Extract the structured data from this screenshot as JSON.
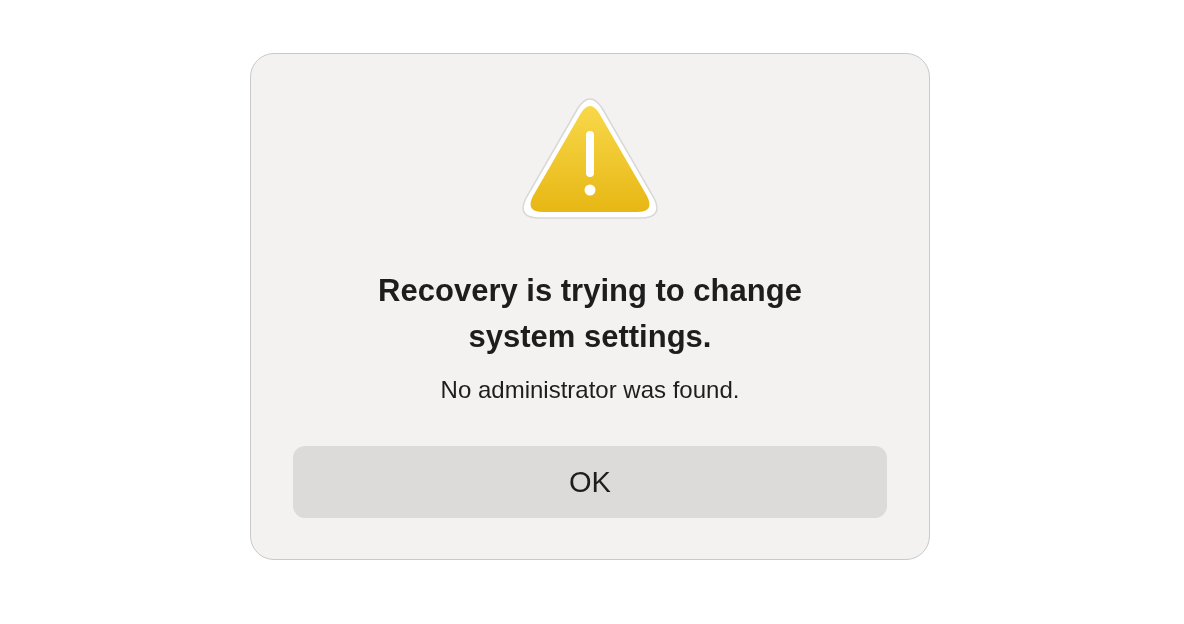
{
  "dialog": {
    "title": "Recovery is trying to change system settings.",
    "message": "No administrator was found.",
    "buttons": [
      {
        "label": "OK"
      }
    ]
  }
}
